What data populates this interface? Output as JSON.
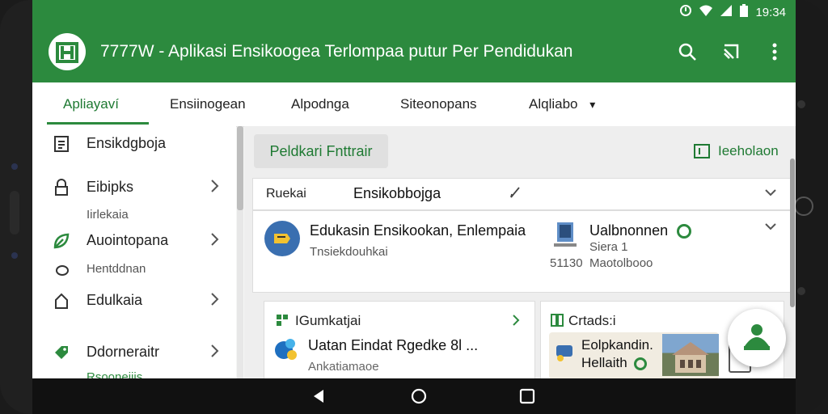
{
  "status": {
    "time": "19:34"
  },
  "app": {
    "title": "7777W - Aplikasi Ensikoogea Terlompaa putur Per Pendidukan"
  },
  "tabs": [
    {
      "label": "Apliayaví"
    },
    {
      "label": "Ensiinogean"
    },
    {
      "label": "Alpodnga"
    },
    {
      "label": "Siteonopans"
    },
    {
      "label": "Alqliabo"
    }
  ],
  "sidebar": {
    "items": [
      {
        "label": "Ensikdgboja",
        "icon": "document-icon"
      },
      {
        "label": "Eibipks",
        "sub": "Iirlekaia",
        "icon": "lock-icon"
      },
      {
        "label": "Auointopana",
        "sub": "Hentddnan",
        "icon": "leaf-icon"
      },
      {
        "label": "Edulkaia",
        "icon": "home-icon"
      },
      {
        "label": "Ddorneraitr",
        "sub": "Rsooneiiis",
        "icon": "tag-icon"
      }
    ]
  },
  "main": {
    "primary_button": "Peldkari Fnttrair",
    "top_link": "Ieeholaon",
    "filter": {
      "label": "Ruekai",
      "value": "Ensikobbojga"
    },
    "featured": {
      "title": "Edukasin Ensikookan, Enlempaia",
      "subtitle": "Tnsiekdouhkai",
      "side_title": "Ualbnonnen",
      "side_sub": "Siera 1",
      "meta_a": "51130",
      "meta_b": "Maotolbooo"
    },
    "card_left": {
      "header": "IGumkatjai",
      "title": "Uatan Eindat Rgedke 8l ...",
      "subtitle": "Ankatiamaoe"
    },
    "card_right": {
      "header": "Crtads:i",
      "mini_title": "Eolpkandin.",
      "mini_sub": "Hellaith"
    }
  },
  "colors": {
    "primary": "#2c8a3e",
    "primary_dark": "#1f7a33"
  }
}
